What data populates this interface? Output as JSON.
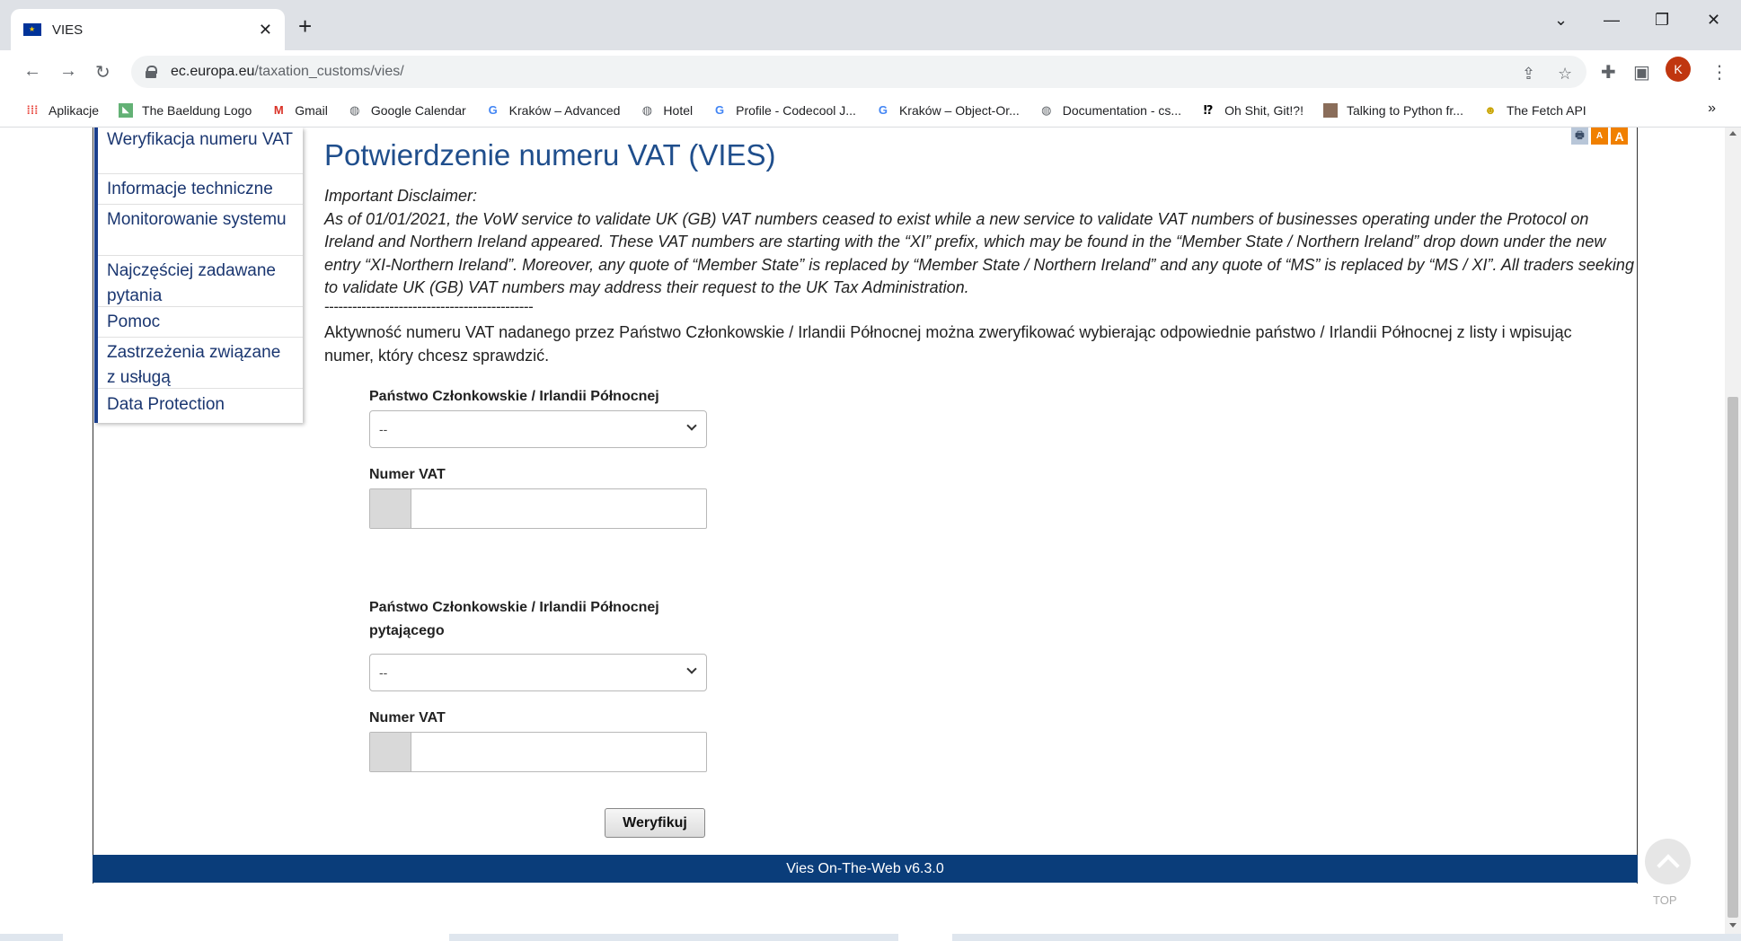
{
  "browser": {
    "tab_title": "VIES",
    "new_tab_icon": "plus-icon",
    "url_host": "ec.europa.eu",
    "url_path": "/taxation_customs/vies/",
    "avatar_letter": "K",
    "bookmarks": [
      {
        "label": "Aplikacje",
        "icon": "apps-grid-icon"
      },
      {
        "label": "The Baeldung Logo",
        "icon": "baeldung-icon"
      },
      {
        "label": "Gmail",
        "icon": "gmail-icon"
      },
      {
        "label": "Google Calendar",
        "icon": "globe-icon"
      },
      {
        "label": "Kraków – Advanced",
        "icon": "google-icon"
      },
      {
        "label": "Hotel",
        "icon": "globe-icon"
      },
      {
        "label": "Profile - Codecool J...",
        "icon": "google-icon"
      },
      {
        "label": "Kraków – Object-Or...",
        "icon": "google-icon"
      },
      {
        "label": "Documentation - cs...",
        "icon": "globe-icon"
      },
      {
        "label": "Oh Shit, Git!?!",
        "icon": "ohshitgit-icon"
      },
      {
        "label": "Talking to Python fr...",
        "icon": "avatar-thumb-icon"
      },
      {
        "label": "The Fetch API",
        "icon": "mdn-icon"
      }
    ],
    "bookmarks_more": "»"
  },
  "sidebar": {
    "items": [
      {
        "label": "Weryfikacja numeru VAT"
      },
      {
        "label": "Informacje techniczne"
      },
      {
        "label": "Monitorowanie systemu"
      },
      {
        "label": "Najczęściej zadawane pytania"
      },
      {
        "label": "Pomoc"
      },
      {
        "label": "Zastrzeżenia związane z usługą"
      },
      {
        "label": "Data Protection"
      }
    ]
  },
  "main": {
    "title": "Potwierdzenie numeru VAT (VIES)",
    "tool_icons": [
      "print-icon",
      "font-decrease-icon",
      "font-increase-icon"
    ],
    "tool_icon_glyphs": {
      "print": "🖶",
      "font_small": "A",
      "font_large": "A"
    },
    "disclaimer_heading": "Important Disclaimer:",
    "disclaimer_text": "As of 01/01/2021, the VoW service to validate UK (GB) VAT numbers ceased to exist while a new service to validate VAT numbers of businesses operating under the Protocol on Ireland and Northern Ireland appeared. These VAT numbers are starting with the “XI” prefix, which may be found in the “Member State / Northern Ireland” drop down under the new entry “XI-Northern Ireland”. Moreover, any quote of “Member State” is replaced by “Member State / Northern Ireland” and any quote of “MS” is replaced by “MS / XI”. All traders seeking to validate UK (GB) VAT numbers may address their request to the UK Tax Administration.",
    "separator": "---------------------------------------------",
    "intro": "Aktywność numeru VAT nadanego przez Państwo Członkowskie / Irlandii Północnej można zweryfikować wybierając odpowiednie państwo / Irlandii Północnej z listy i wpisując numer, który chcesz sprawdzić."
  },
  "form": {
    "member_state_label": "Państwo Członkowskie / Irlandii Północnej",
    "member_state_value": "--",
    "vat_label": "Numer VAT",
    "vat_value": "",
    "requester_state_label": "Państwo Członkowskie / Irlandii Północnej pytającego",
    "requester_state_value": "--",
    "requester_vat_label": "Numer VAT",
    "requester_vat_value": "",
    "verify_button": "Weryfikuj"
  },
  "footer": {
    "version": "Vies On-The-Web v6.3.0",
    "top_label": "TOP"
  },
  "colors": {
    "title_blue": "#1f4e8c",
    "footer_bg": "#0a3d7a",
    "sidebar_accent": "#1a3e8c"
  }
}
